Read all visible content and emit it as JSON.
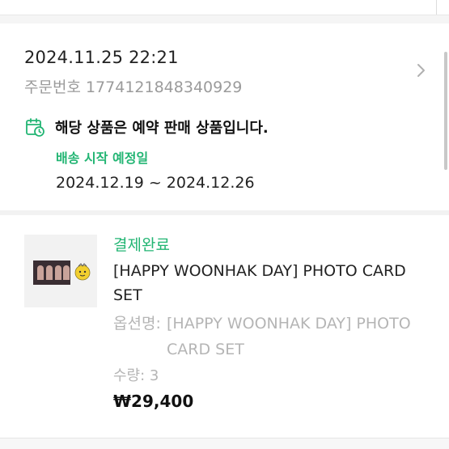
{
  "order": {
    "datetime": "2024.11.25 22:21",
    "order_number_label": "주문번호",
    "order_number": "1774121848340929",
    "detail_arrow_icon": "chevron-right-icon"
  },
  "preorder": {
    "icon": "calendar-clock-icon",
    "notice": "해당 상품은 예약 판매 상품입니다.",
    "ship_label": "배송 시작 예정일",
    "ship_range": "2024.12.19 ~ 2024.12.26"
  },
  "item": {
    "status": "결제완료",
    "title": "[HAPPY WOONHAK DAY] PHOTO CARD SET",
    "option_label": "옵션명:",
    "option_value": "[HAPPY WOONHAK DAY] PHOTO CARD SET",
    "quantity_label": "수량:",
    "quantity": "3",
    "price": "₩29,400"
  },
  "colors": {
    "accent_green": "#22b573",
    "muted_gray": "#9b9b9b",
    "divider": "#f5f5f5"
  }
}
